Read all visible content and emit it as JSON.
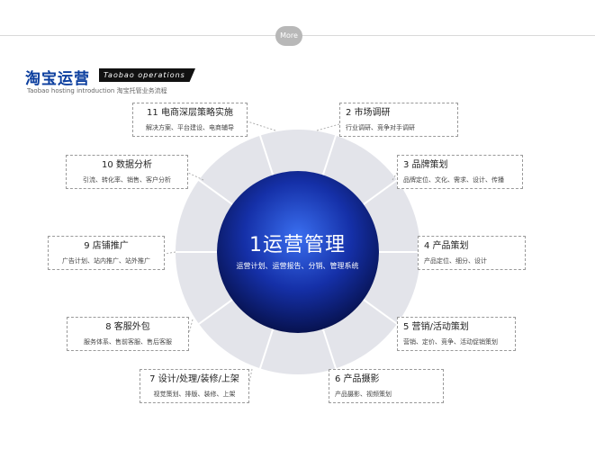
{
  "header": {
    "more_label": "More",
    "title_cn": "淘宝运营",
    "title_en": "Taobao operations",
    "subtitle_en": "Taobao hosting introduction",
    "subtitle_cn": "淘宝托管业务流程"
  },
  "center": {
    "title": "1运营管理",
    "subtitle": "运营计划、运营报告、分销、管理系统"
  },
  "items": [
    {
      "title": "2 市场调研",
      "desc": "行业调研、竞争对手调研"
    },
    {
      "title": "3 品牌策划",
      "desc": "品牌定位、文化、需求、设计、传播"
    },
    {
      "title": "4 产品策划",
      "desc": "产品定位、细分、设计"
    },
    {
      "title": "5 营销/活动策划",
      "desc": "营销、定价、竞争、活动促销策划"
    },
    {
      "title": "6 产品摄影",
      "desc": "产品摄影、视频策划"
    },
    {
      "title": "7 设计/处理/装修/上架",
      "desc": "视觉策划、排版、装修、上架"
    },
    {
      "title": "8 客服外包",
      "desc": "服务体系、售前客服、售后客服"
    },
    {
      "title": "9 店铺推广",
      "desc": "广告计划、站内推广、站外推广"
    },
    {
      "title": "10 数据分析",
      "desc": "引流、转化率、销售、客户分析"
    },
    {
      "title": "11 电商深层策略实施",
      "desc": "解决方案、平台建设、电商辅导"
    }
  ],
  "colors": {
    "title_blue": "#0b3e9e",
    "ring_gray": "#e3e4ea",
    "center_light": "#3a6ff0",
    "center_dark": "#07124f"
  }
}
